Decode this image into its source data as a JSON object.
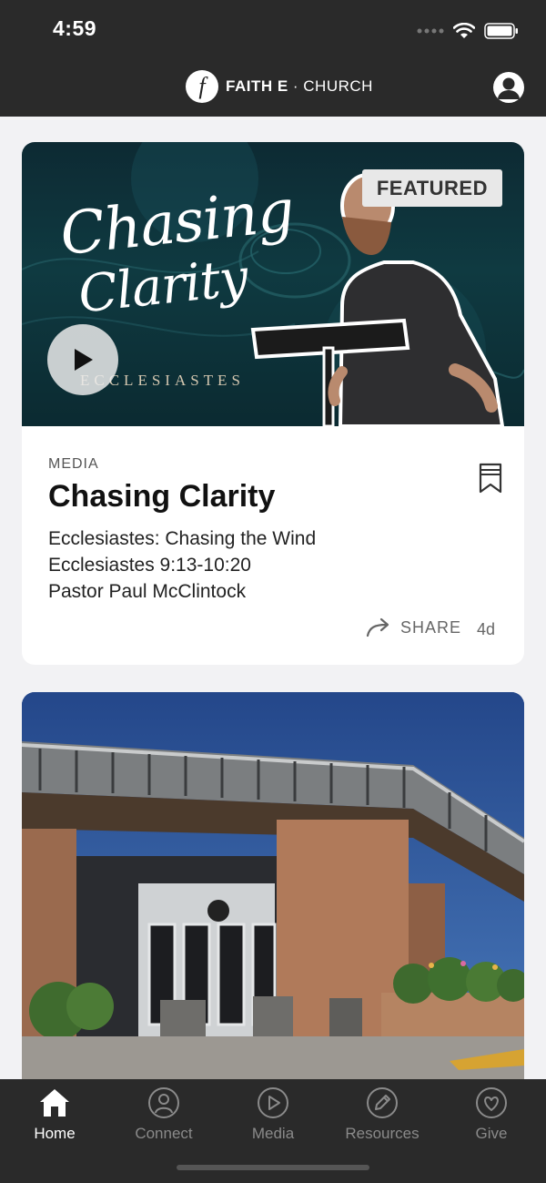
{
  "status_bar": {
    "time": "4:59"
  },
  "header": {
    "logo_letter": "f",
    "brand_bold": "FAITH E",
    "brand_sep": " · ",
    "brand_rest": "CHURCH"
  },
  "featured_card": {
    "badge": "FEATURED",
    "hero_title_line1": "Chasing",
    "hero_title_line2": "Clarity",
    "hero_subtitle": "ECCLESIASTES",
    "kind": "MEDIA",
    "title": "Chasing Clarity",
    "series": "Ecclesiastes: Chasing the Wind",
    "scripture": "Ecclesiastes 9:13-10:20",
    "speaker": "Pastor Paul McClintock",
    "share_label": "SHARE",
    "age": "4d"
  },
  "tabs": [
    {
      "label": "Home",
      "icon": "home-icon",
      "active": true
    },
    {
      "label": "Connect",
      "icon": "person-icon",
      "active": false
    },
    {
      "label": "Media",
      "icon": "play-icon",
      "active": false
    },
    {
      "label": "Resources",
      "icon": "pencil-icon",
      "active": false
    },
    {
      "label": "Give",
      "icon": "heart-icon",
      "active": false
    }
  ],
  "colors": {
    "bar_background": "#2a2a2a",
    "page_background": "#f2f2f4",
    "active_tab": "#ffffff",
    "inactive_tab": "#8a8a8a"
  }
}
